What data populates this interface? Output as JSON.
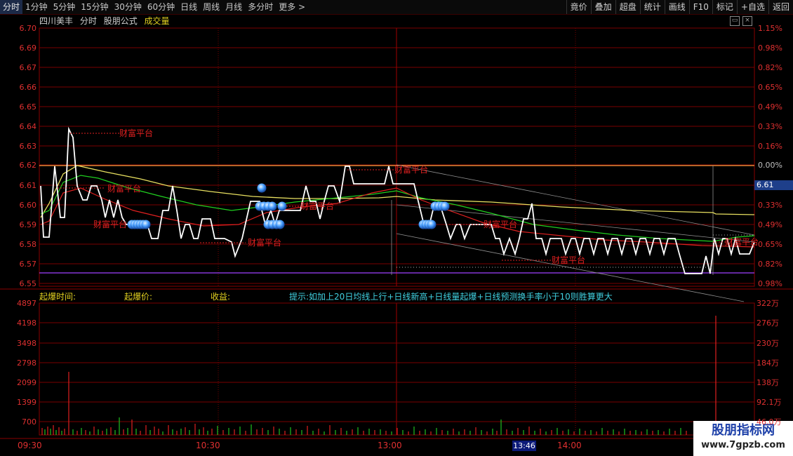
{
  "toolbar": {
    "left_items": [
      {
        "label": "分时",
        "active": true
      },
      {
        "label": "1分钟"
      },
      {
        "label": "5分钟"
      },
      {
        "label": "15分钟"
      },
      {
        "label": "30分钟"
      },
      {
        "label": "60分钟"
      },
      {
        "label": "日线"
      },
      {
        "label": "周线"
      },
      {
        "label": "月线"
      },
      {
        "label": "多分时"
      },
      {
        "label": "更多 >"
      }
    ],
    "right_items": [
      "竟价",
      "叠加",
      "超盘",
      "统计",
      "画线",
      "F10",
      "标记",
      "+自选",
      "返回"
    ]
  },
  "header": {
    "stock_name": "四川美丰",
    "mode": "分时",
    "formula": "股朋公式",
    "indicator": "成交量"
  },
  "price_axis": {
    "left": [
      "6.70",
      "6.69",
      "6.67",
      "6.66",
      "6.65",
      "6.64",
      "6.63",
      "6.62",
      "6.61",
      "6.60",
      "6.59",
      "6.58",
      "6.57",
      "6.55"
    ],
    "right": [
      "1.15%",
      "0.98%",
      "0.82%",
      "0.65%",
      "0.49%",
      "0.33%",
      "0.16%",
      "0.00%",
      "",
      "0.33%",
      "0.49%",
      "0.65%",
      "0.82%",
      "0.98%"
    ],
    "current_price": "6.61"
  },
  "platform_label": "财富平台",
  "signal_row": {
    "explode_time": "起爆时间:",
    "explode_price": "起爆价:",
    "profit": "收益:",
    "hint": "提示:如加上20日均线上行+日线新高+日线量起爆+日线预测换手率小于10则胜算更大"
  },
  "volume_axis": {
    "left": [
      "4897",
      "4198",
      "3498",
      "2798",
      "2099",
      "1399",
      "700"
    ],
    "right": [
      "322万",
      "276万",
      "230万",
      "184万",
      "138万",
      "92.1万",
      "46.0万"
    ]
  },
  "time_axis": {
    "labels": [
      "09:30",
      "10:30",
      "13:00",
      "14:00"
    ],
    "cursor_time": "13:46"
  },
  "watermark": {
    "title": "股朋指标网",
    "url": "www.7gpzb.com"
  },
  "colors": {
    "background": "#000000",
    "grid_red": "#7a0000",
    "price_line": "#ffffff",
    "avg_yellow": "#e8e060",
    "ma_green": "#20d020",
    "ma_red": "#e02020",
    "support_purple": "#a040ff",
    "orange_ref": "#ffa040",
    "volume_up": "#e02020",
    "volume_down": "#20c020",
    "hint_cyan": "#40d0e0",
    "signal_yellow": "#e0d020",
    "ball_blue": "#4aa0ff"
  }
}
